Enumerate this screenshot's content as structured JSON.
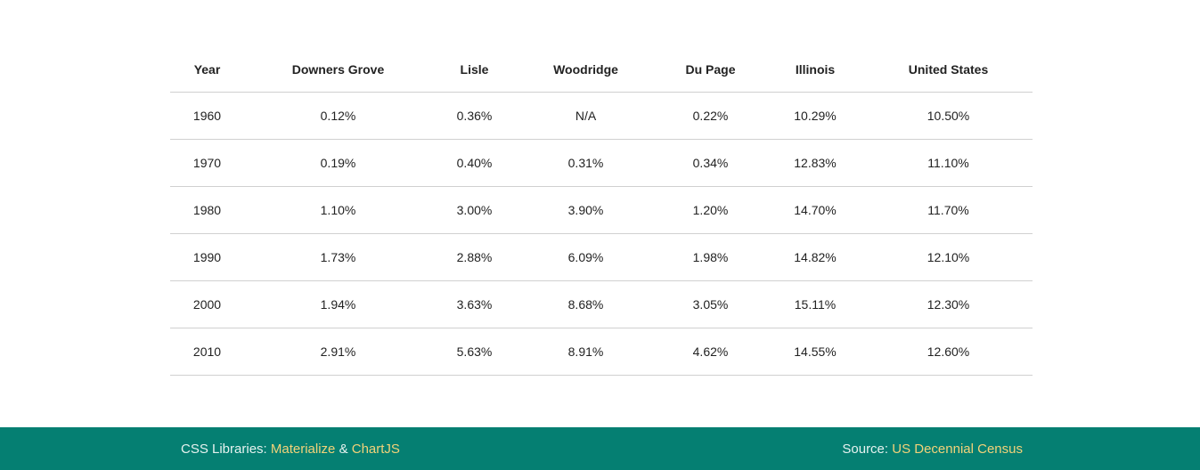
{
  "table": {
    "headers": [
      "Year",
      "Downers Grove",
      "Lisle",
      "Woodridge",
      "Du Page",
      "Illinois",
      "United States"
    ],
    "rows": [
      [
        "1960",
        "0.12%",
        "0.36%",
        "N/A",
        "0.22%",
        "10.29%",
        "10.50%"
      ],
      [
        "1970",
        "0.19%",
        "0.40%",
        "0.31%",
        "0.34%",
        "12.83%",
        "11.10%"
      ],
      [
        "1980",
        "1.10%",
        "3.00%",
        "3.90%",
        "1.20%",
        "14.70%",
        "11.70%"
      ],
      [
        "1990",
        "1.73%",
        "2.88%",
        "6.09%",
        "1.98%",
        "14.82%",
        "12.10%"
      ],
      [
        "2000",
        "1.94%",
        "3.63%",
        "8.68%",
        "3.05%",
        "15.11%",
        "12.30%"
      ],
      [
        "2010",
        "2.91%",
        "5.63%",
        "8.91%",
        "4.62%",
        "14.55%",
        "12.60%"
      ]
    ]
  },
  "footer": {
    "libraries_prefix": "CSS Libraries: ",
    "lib1": "Materialize",
    "amp": " & ",
    "lib2": "ChartJS",
    "source_prefix": "Source: ",
    "source_link": "US Decennial Census"
  },
  "colors": {
    "footer_bg": "#057f72",
    "link": "#f2d279"
  }
}
